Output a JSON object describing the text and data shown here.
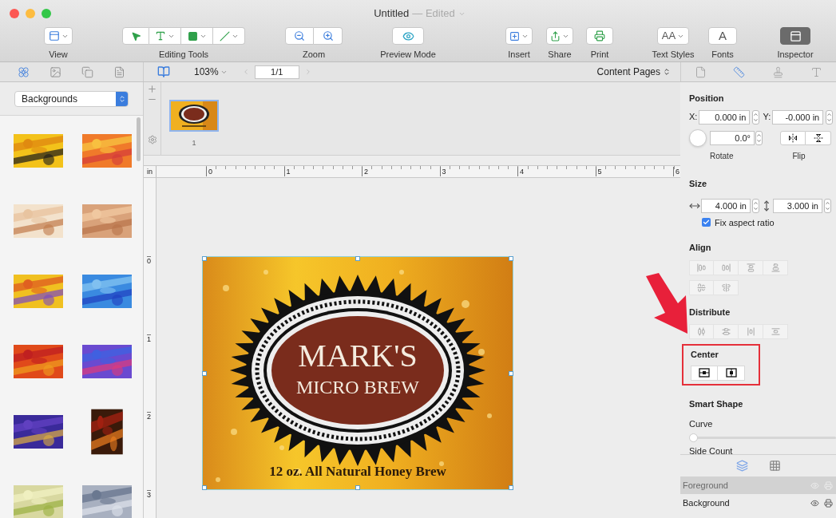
{
  "window": {
    "title": "Untitled",
    "subtitle": "— Edited"
  },
  "toolbar": [
    {
      "kind": "view",
      "label": "View",
      "selected": false
    },
    {
      "kind": "editing",
      "label": "Editing Tools",
      "selected": false
    },
    {
      "kind": "zoom",
      "label": "Zoom",
      "selected": false
    },
    {
      "kind": "preview",
      "label": "Preview Mode",
      "selected": false
    },
    {
      "kind": "insert",
      "label": "Insert",
      "selected": false
    },
    {
      "kind": "share",
      "label": "Share",
      "selected": false
    },
    {
      "kind": "print",
      "label": "Print",
      "selected": false
    },
    {
      "kind": "textstyles",
      "label": "Text Styles",
      "glyph": "AA",
      "selected": false
    },
    {
      "kind": "fonts",
      "label": "Fonts",
      "glyph": "A",
      "selected": false
    },
    {
      "kind": "inspector",
      "label": "Inspector",
      "selected": true
    }
  ],
  "library": {
    "tabs": [
      {
        "selected": true
      },
      {
        "selected": false
      },
      {
        "selected": false
      },
      {
        "selected": false
      }
    ],
    "category": "Backgrounds"
  },
  "pagebar": {
    "zoom": "103%",
    "page": "1/1",
    "view_menu": "Content Pages"
  },
  "pages": [
    {
      "number": "1",
      "selected": true
    }
  ],
  "ruler": {
    "unit": "in",
    "marks": [
      "0",
      "1",
      "2",
      "3",
      "4",
      "5",
      "6"
    ],
    "vertical_marks": [
      "0",
      "1",
      "2",
      "3"
    ]
  },
  "document": {
    "title": "MARK'S",
    "subtitle": "MICRO BREW",
    "tagline": "12 oz. All Natural Honey Brew",
    "selected": true
  },
  "inspector": {
    "tabs": [
      {
        "selected": false
      },
      {
        "selected": true
      },
      {
        "selected": false
      },
      {
        "selected": false
      }
    ],
    "position": {
      "heading": "Position",
      "x_label": "X:",
      "x": "0.000 in",
      "y_label": "Y:",
      "y": "-0.000 in",
      "angle": "0.0°",
      "rotate_label": "Rotate",
      "flip_label": "Flip"
    },
    "size": {
      "heading": "Size",
      "width": "4.000 in",
      "height": "3.000 in",
      "aspect_label": "Fix aspect ratio",
      "aspect_checked": true
    },
    "align": {
      "heading": "Align",
      "buttons": [
        {
          "disabled": true
        },
        {
          "disabled": true
        },
        {
          "disabled": true
        },
        {
          "disabled": true
        },
        {
          "disabled": true
        },
        {
          "disabled": true
        }
      ]
    },
    "distribute": {
      "heading": "Distribute",
      "buttons": [
        {
          "disabled": true
        },
        {
          "disabled": true
        },
        {
          "disabled": true
        },
        {
          "disabled": true
        }
      ]
    },
    "center": {
      "heading": "Center",
      "highlighted": true,
      "buttons": [
        {
          "disabled": false
        },
        {
          "disabled": false
        }
      ]
    },
    "smart_shape": {
      "heading": "Smart Shape",
      "curve_label": "Curve",
      "curve": {
        "level": 0
      },
      "side_count_label": "Side Count"
    },
    "bottom_tabs": [
      {
        "selected": true
      },
      {
        "selected": false
      }
    ],
    "layers": [
      {
        "name": "Foreground",
        "selected": true
      },
      {
        "name": "Background",
        "selected": false
      }
    ]
  },
  "annotation_arrow": true
}
